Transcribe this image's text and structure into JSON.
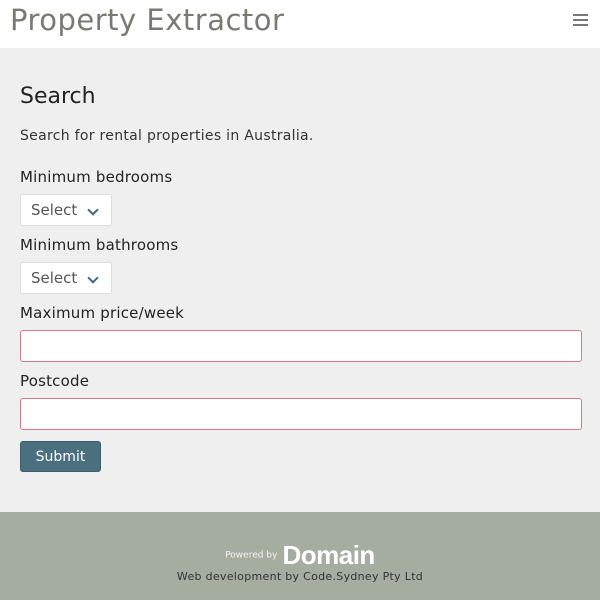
{
  "header": {
    "title": "Property Extractor",
    "menu_icon": "hamburger-menu-icon"
  },
  "search": {
    "title": "Search",
    "intro": "Search for rental properties in Australia.",
    "bedrooms": {
      "label": "Minimum bedrooms",
      "value": "Select"
    },
    "bathrooms": {
      "label": "Minimum bathrooms",
      "value": "Select"
    },
    "price": {
      "label": "Maximum price/week",
      "value": ""
    },
    "postcode": {
      "label": "Postcode",
      "value": ""
    },
    "submit_label": "Submit"
  },
  "footer": {
    "powered_by": "Powered by",
    "brand": "Domain",
    "credit": "Web development by Code.Sydney Pty Ltd"
  },
  "colors": {
    "accent": "#4a7080",
    "footer_bg": "#a5ada0",
    "invalid_border": "#d77a85"
  }
}
